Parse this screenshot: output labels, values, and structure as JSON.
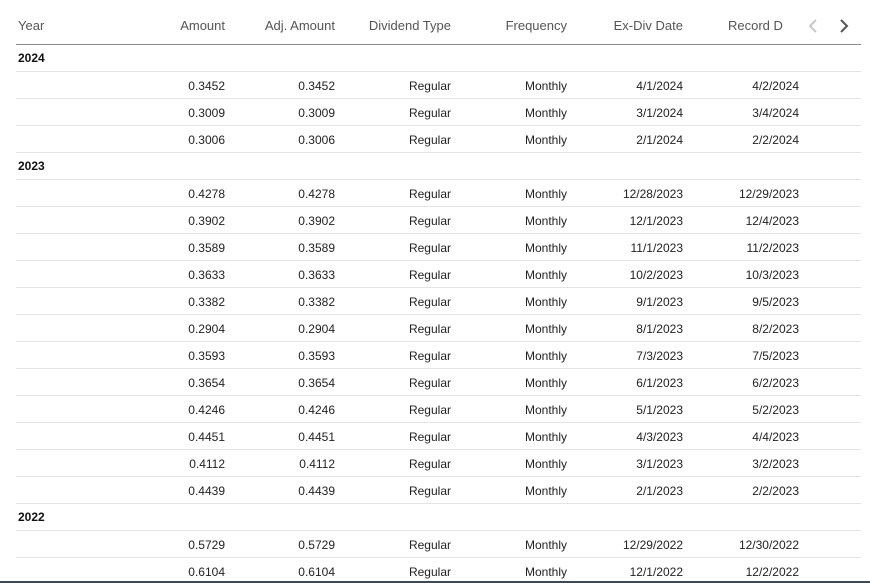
{
  "header": {
    "columns": {
      "year": "Year",
      "amount": "Amount",
      "adj_amount": "Adj. Amount",
      "dividend_type": "Dividend Type",
      "frequency": "Frequency",
      "ex_div_date": "Ex-Div Date",
      "record_date": "Record D"
    },
    "nav_prev_icon": "chevron-left-icon",
    "nav_next_icon": "chevron-right-icon"
  },
  "groups": [
    {
      "year": "2024",
      "rows": [
        {
          "amount": "0.3452",
          "adj_amount": "0.3452",
          "type": "Regular",
          "frequency": "Monthly",
          "ex_div": "4/1/2024",
          "record": "4/2/2024"
        },
        {
          "amount": "0.3009",
          "adj_amount": "0.3009",
          "type": "Regular",
          "frequency": "Monthly",
          "ex_div": "3/1/2024",
          "record": "3/4/2024"
        },
        {
          "amount": "0.3006",
          "adj_amount": "0.3006",
          "type": "Regular",
          "frequency": "Monthly",
          "ex_div": "2/1/2024",
          "record": "2/2/2024"
        }
      ]
    },
    {
      "year": "2023",
      "rows": [
        {
          "amount": "0.4278",
          "adj_amount": "0.4278",
          "type": "Regular",
          "frequency": "Monthly",
          "ex_div": "12/28/2023",
          "record": "12/29/2023"
        },
        {
          "amount": "0.3902",
          "adj_amount": "0.3902",
          "type": "Regular",
          "frequency": "Monthly",
          "ex_div": "12/1/2023",
          "record": "12/4/2023"
        },
        {
          "amount": "0.3589",
          "adj_amount": "0.3589",
          "type": "Regular",
          "frequency": "Monthly",
          "ex_div": "11/1/2023",
          "record": "11/2/2023"
        },
        {
          "amount": "0.3633",
          "adj_amount": "0.3633",
          "type": "Regular",
          "frequency": "Monthly",
          "ex_div": "10/2/2023",
          "record": "10/3/2023"
        },
        {
          "amount": "0.3382",
          "adj_amount": "0.3382",
          "type": "Regular",
          "frequency": "Monthly",
          "ex_div": "9/1/2023",
          "record": "9/5/2023"
        },
        {
          "amount": "0.2904",
          "adj_amount": "0.2904",
          "type": "Regular",
          "frequency": "Monthly",
          "ex_div": "8/1/2023",
          "record": "8/2/2023"
        },
        {
          "amount": "0.3593",
          "adj_amount": "0.3593",
          "type": "Regular",
          "frequency": "Monthly",
          "ex_div": "7/3/2023",
          "record": "7/5/2023"
        },
        {
          "amount": "0.3654",
          "adj_amount": "0.3654",
          "type": "Regular",
          "frequency": "Monthly",
          "ex_div": "6/1/2023",
          "record": "6/2/2023"
        },
        {
          "amount": "0.4246",
          "adj_amount": "0.4246",
          "type": "Regular",
          "frequency": "Monthly",
          "ex_div": "5/1/2023",
          "record": "5/2/2023"
        },
        {
          "amount": "0.4451",
          "adj_amount": "0.4451",
          "type": "Regular",
          "frequency": "Monthly",
          "ex_div": "4/3/2023",
          "record": "4/4/2023"
        },
        {
          "amount": "0.4112",
          "adj_amount": "0.4112",
          "type": "Regular",
          "frequency": "Monthly",
          "ex_div": "3/1/2023",
          "record": "3/2/2023"
        },
        {
          "amount": "0.4439",
          "adj_amount": "0.4439",
          "type": "Regular",
          "frequency": "Monthly",
          "ex_div": "2/1/2023",
          "record": "2/2/2023"
        }
      ]
    },
    {
      "year": "2022",
      "rows": [
        {
          "amount": "0.5729",
          "adj_amount": "0.5729",
          "type": "Regular",
          "frequency": "Monthly",
          "ex_div": "12/29/2022",
          "record": "12/30/2022"
        },
        {
          "amount": "0.6104",
          "adj_amount": "0.6104",
          "type": "Regular",
          "frequency": "Monthly",
          "ex_div": "12/1/2022",
          "record": "12/2/2022"
        }
      ]
    }
  ],
  "colors": {
    "header_border": "#8a8a8a",
    "row_border": "#e4e4e4",
    "nav_disabled": "#c8c8c8",
    "nav_enabled": "#555555",
    "bottom_bar": "#3a4a5a"
  }
}
